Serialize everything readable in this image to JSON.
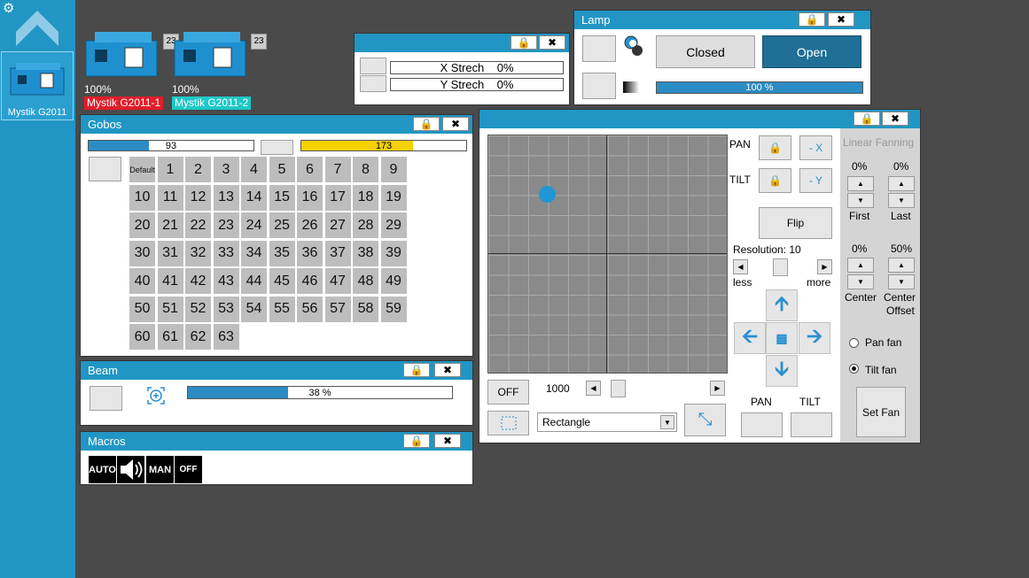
{
  "sidebar": {
    "settings_icon": "gear-icon",
    "up_icon": "chevron-up-icon",
    "device_label": "Mystik G2011"
  },
  "fixtures": [
    {
      "pct": "100%",
      "badge": "23",
      "name": "Mystik G2011-1",
      "tag_color": "#e11d2a"
    },
    {
      "pct": "100%",
      "badge": "23",
      "name": "Mystik G2011-2",
      "tag_color": "#1ec8c8"
    }
  ],
  "stretch_window": {
    "x_label": "X Strech",
    "x_value": "0%",
    "y_label": "Y Strech",
    "y_value": "0%"
  },
  "lamp_window": {
    "title": "Lamp",
    "closed_label": "Closed",
    "open_label": "Open",
    "dimmer_text": "100 %",
    "dimmer_level": 1.0
  },
  "gobos_window": {
    "title": "Gobos",
    "left_bar_text": "93",
    "left_bar_level": 0.365,
    "right_bar_text": "173",
    "right_bar_level": 0.678,
    "default_label": "Default",
    "gobos": [
      "1",
      "2",
      "3",
      "4",
      "5",
      "6",
      "7",
      "8",
      "9",
      "10",
      "11",
      "12",
      "13",
      "14",
      "15",
      "16",
      "17",
      "18",
      "19",
      "20",
      "21",
      "22",
      "23",
      "24",
      "25",
      "26",
      "27",
      "28",
      "29",
      "30",
      "31",
      "32",
      "33",
      "34",
      "35",
      "36",
      "37",
      "38",
      "39",
      "40",
      "41",
      "42",
      "43",
      "44",
      "45",
      "46",
      "47",
      "48",
      "49",
      "50",
      "51",
      "52",
      "53",
      "54",
      "55",
      "56",
      "57",
      "58",
      "59",
      "60",
      "61",
      "62",
      "63"
    ]
  },
  "beam_window": {
    "title": "Beam",
    "bar_text": "38 %",
    "bar_level": 0.38
  },
  "macros_window": {
    "title": "Macros",
    "auto": "AUTO",
    "man": "MAN",
    "off": "OFF"
  },
  "pantilt_window": {
    "pan_label": "PAN",
    "tilt_label": "TILT",
    "minus_x": "- X",
    "minus_y": "- Y",
    "flip": "Flip",
    "resolution": "Resolution: 10",
    "less": "less",
    "more": "more",
    "off": "OFF",
    "speed": "1000",
    "shape": "Rectangle",
    "pan_bottom": "PAN",
    "tilt_bottom": "TILT",
    "fanning_title": "Linear Fanning",
    "first_pct": "0%",
    "first_label": "First",
    "last_pct": "0%",
    "last_label": "Last",
    "center_pct": "0%",
    "center_label": "Center",
    "offset_pct": "50%",
    "offset_label_1": "Center",
    "offset_label_2": "Offset",
    "pan_fan": "Pan fan",
    "tilt_fan": "Tilt fan",
    "set_fan": "Set Fan"
  }
}
